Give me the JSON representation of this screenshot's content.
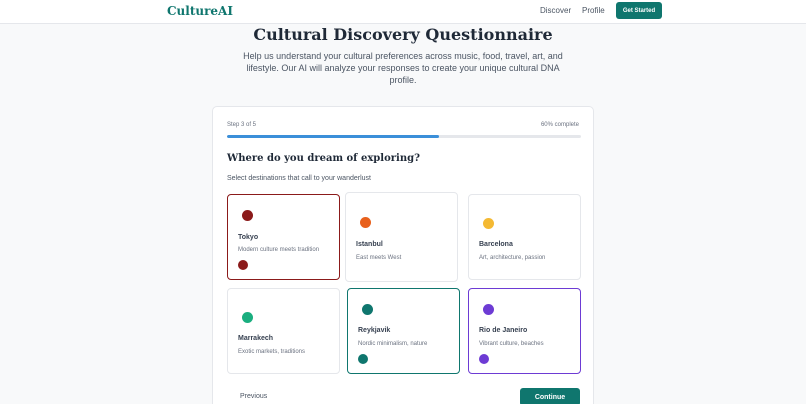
{
  "header": {
    "logo": "CultureAI",
    "nav": [
      {
        "label": "Discover"
      },
      {
        "label": "Profile"
      }
    ],
    "cta_label": "Get Started"
  },
  "hero": {
    "title": "Cultural Discovery Questionnaire",
    "subtitle": "Help us understand your cultural preferences across music, food, travel, art, and lifestyle. Our AI will analyze your responses to create your unique cultural DNA profile."
  },
  "questionnaire": {
    "step_text": "Step 3 of 5",
    "progress_text": "60% complete",
    "progress_fraction": 0.6,
    "question": "Where do you dream of exploring?",
    "instruction": "Select destinations that call to your wanderlust",
    "options": [
      {
        "name": "Tokyo",
        "description": "Modern culture meets tradition",
        "color": "#8b1a1a",
        "selected": true
      },
      {
        "name": "Istanbul",
        "description": "East meets West",
        "color": "#e8601c",
        "selected": false
      },
      {
        "name": "Barcelona",
        "description": "Art, architecture, passion",
        "color": "#f4b933",
        "selected": false
      },
      {
        "name": "Marrakech",
        "description": "Exotic markets, traditions",
        "color": "#1aae7f",
        "selected": false
      },
      {
        "name": "Reykjavik",
        "description": "Nordic minimalism, nature",
        "color": "#0f766e",
        "selected": true
      },
      {
        "name": "Rio de Janeiro",
        "description": "Vibrant culture, beaches",
        "color": "#6d3bd4",
        "selected": true
      }
    ],
    "previous_label": "Previous",
    "continue_label": "Continue"
  }
}
